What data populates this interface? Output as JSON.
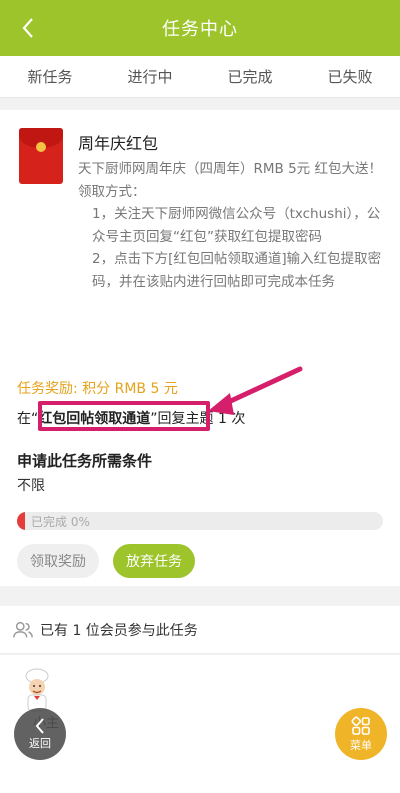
{
  "header": {
    "title": "任务中心"
  },
  "tabs": [
    {
      "label": "新任务"
    },
    {
      "label": "进行中"
    },
    {
      "label": "已完成"
    },
    {
      "label": "已失败"
    }
  ],
  "task": {
    "title": "周年庆红包",
    "desc_line1": "天下厨师网周年庆（四周年）RMB 5元 红包大送！",
    "desc_label": "领取方式：",
    "step1": "1，关注天下厨师网微信公众号（txchushi），公众号主页回复“红包”获取红包提取密码",
    "step2": "2，点击下方[红包回帖领取通道]输入红包提取密码，并在该贴内进行回帖即可完成本任务",
    "reward": "任务奖励: 积分 RMB 5 元",
    "reply_prefix": "在“",
    "reply_link": "红包回帖领取通道",
    "reply_suffix": "”回复主题 1 次",
    "req_title": "申请此任务所需条件",
    "req_value": "不限",
    "progress_text": "已完成 0%",
    "progress_value": 0,
    "claim_label": "领取奖励",
    "abandon_label": "放弃任务"
  },
  "members": {
    "text": "已有 1 位会员参与此任务"
  },
  "participant": {
    "name": "小主"
  },
  "fab": {
    "back_label": "返回",
    "menu_label": "菜单"
  },
  "colors": {
    "brand": "#9dc42b",
    "reward": "#e5a21a",
    "annotation": "#d61f6b",
    "menu_fab": "#f0b428"
  },
  "icons": {
    "back": "chevron-left-icon",
    "redpacket": "red-envelope-icon",
    "members": "people-icon",
    "menu": "grid-icon"
  }
}
